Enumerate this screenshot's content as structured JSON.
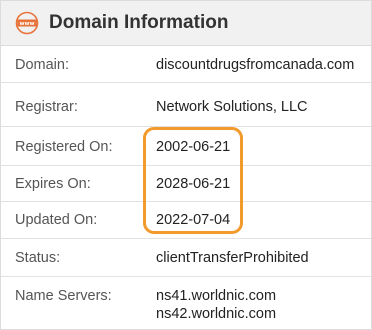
{
  "header": {
    "title": "Domain Information",
    "icon_text": "www",
    "accent_color": "#e8733a"
  },
  "rows": [
    {
      "label": "Domain:",
      "value": "discountdrugsfromcanada.com"
    },
    {
      "label": "Registrar:",
      "value": "Network Solutions, LLC"
    },
    {
      "label": "Registered On:",
      "value": "2002-06-21"
    },
    {
      "label": "Expires On:",
      "value": "2028-06-21"
    },
    {
      "label": "Updated On:",
      "value": "2022-07-04"
    },
    {
      "label": "Status:",
      "value": "clientTransferProhibited"
    },
    {
      "label": "Name Servers:",
      "values": [
        "ns41.worldnic.com",
        "ns42.worldnic.com"
      ]
    }
  ],
  "highlight": {
    "color": "#f39a2d",
    "covers": [
      "Registered On:",
      "Expires On:",
      "Updated On:"
    ]
  }
}
